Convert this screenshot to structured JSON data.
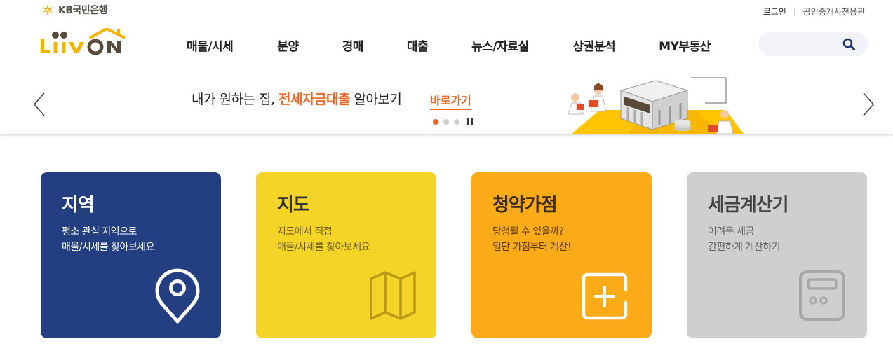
{
  "header": {
    "bank_name": "KB국민은행",
    "service_logo": "LiiV ON",
    "top_links": {
      "login": "로그인",
      "agent": "공인중개사전용관"
    },
    "nav": [
      "매물/시세",
      "분양",
      "경매",
      "대출",
      "뉴스/자료실",
      "상권분석",
      "MY부동산"
    ],
    "search": {
      "placeholder": "",
      "icon": "search-icon"
    }
  },
  "banner": {
    "text_prefix": "내가 원하는 집, ",
    "text_highlight": "전세자금대출",
    "text_suffix": " 알아보기",
    "link_label": "바로가기",
    "slide_count": 3,
    "active_slide": 1,
    "accent_color": "#f26522"
  },
  "cards": [
    {
      "title": "지역",
      "desc": [
        "평소 관심 지역으로",
        "매물/시세를 찾아보세요"
      ],
      "icon": "location-pin-icon",
      "color": "#233f82"
    },
    {
      "title": "지도",
      "desc": [
        "지도에서 직접",
        "매물/시세를 찾아보세요"
      ],
      "icon": "folded-map-icon",
      "color": "#f4d527"
    },
    {
      "title": "청약가점",
      "desc": [
        "당첨될 수 있을까?",
        "일단 가점부터 계산!"
      ],
      "icon": "plus-box-icon",
      "color": "#fbab18"
    },
    {
      "title": "세금계산기",
      "desc": [
        "어려운 세금",
        "간편하게 계산하기"
      ],
      "icon": "calculator-icon",
      "color": "#d0cfd0"
    }
  ]
}
